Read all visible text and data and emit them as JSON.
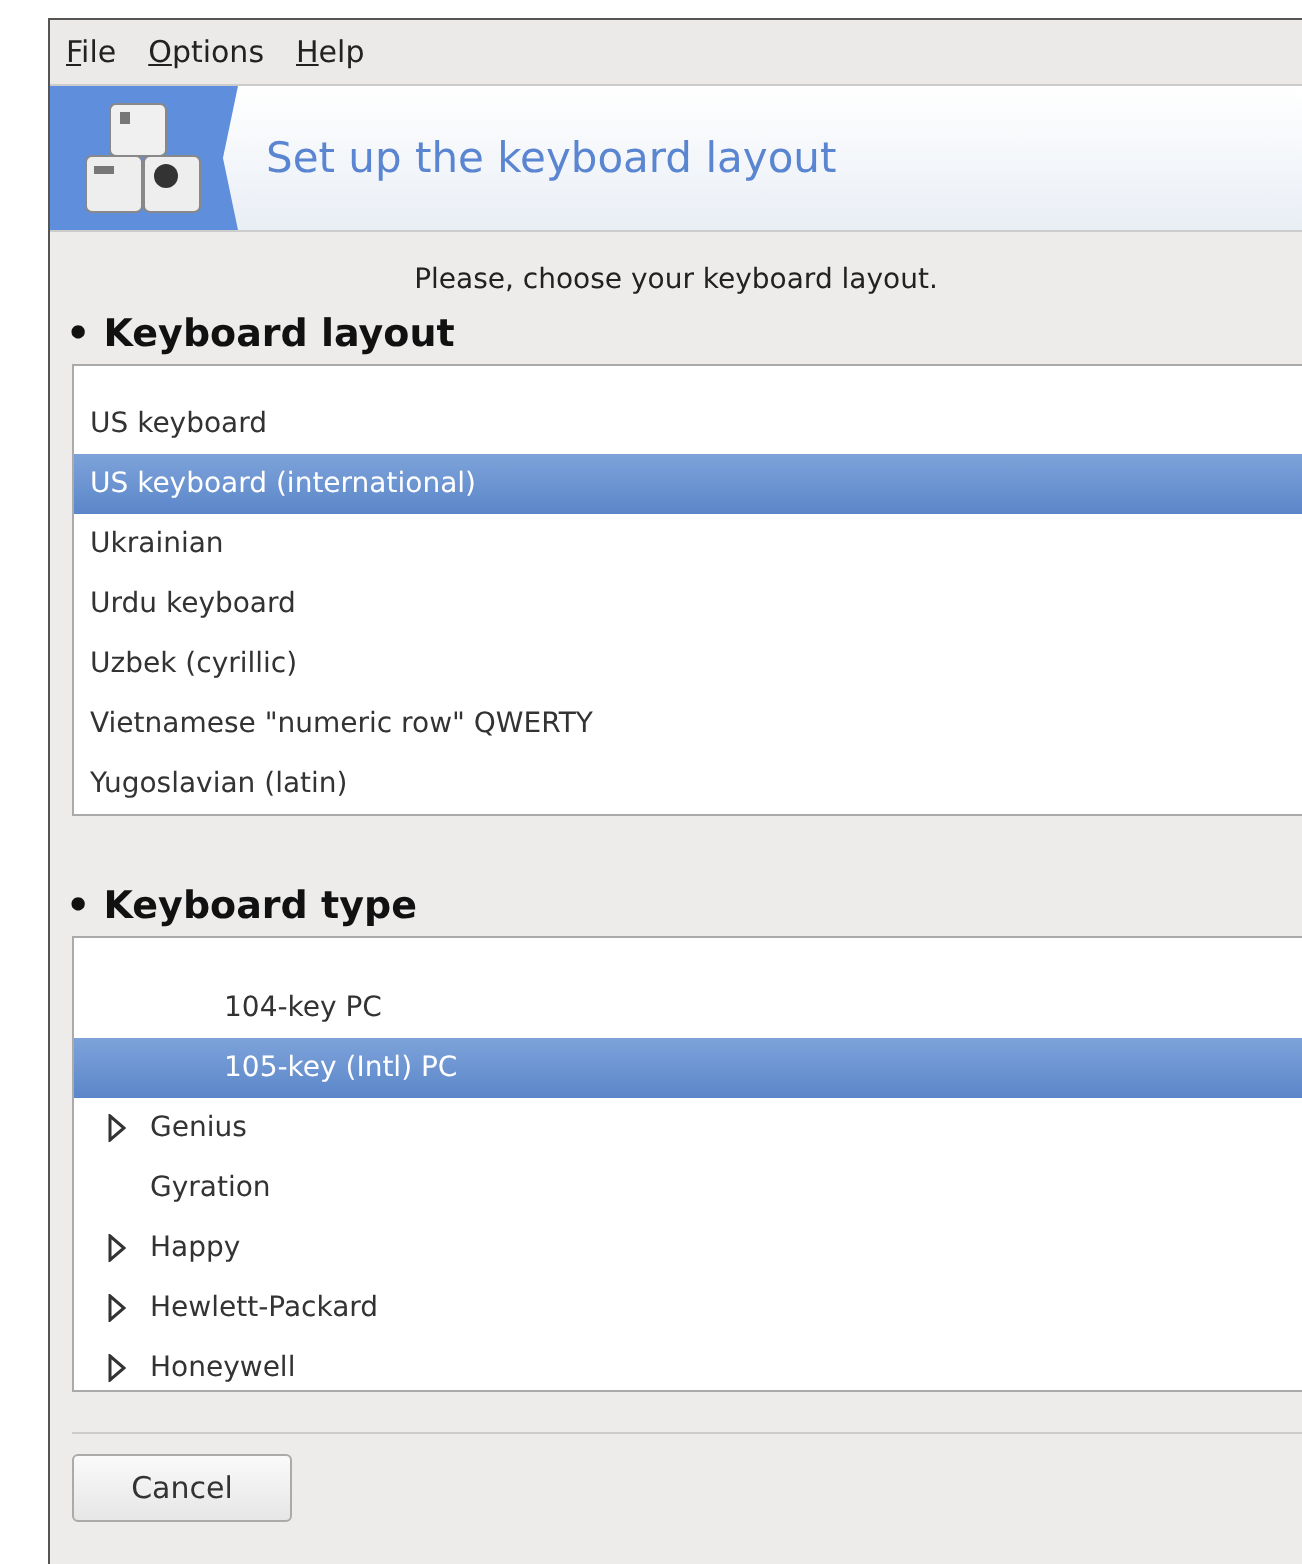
{
  "menu": [
    "File",
    "Options",
    "Help"
  ],
  "banner": {
    "title": "Set up the keyboard layout"
  },
  "prompt": "Please, choose your keyboard layout.",
  "layout_section": {
    "bullet": "•",
    "heading": "Keyboard layout",
    "items": [
      {
        "label": "US keyboard",
        "selected": false
      },
      {
        "label": "US keyboard (international)",
        "selected": true
      },
      {
        "label": "Ukrainian",
        "selected": false
      },
      {
        "label": "Urdu keyboard",
        "selected": false
      },
      {
        "label": "Uzbek (cyrillic)",
        "selected": false
      },
      {
        "label": "Vietnamese \"numeric row\" QWERTY",
        "selected": false
      },
      {
        "label": "Yugoslavian (latin)",
        "selected": false
      }
    ]
  },
  "type_section": {
    "bullet": "•",
    "heading": "Keyboard type",
    "items": [
      {
        "children": [
          {
            "label": "104-key PC",
            "selected": false
          },
          {
            "label": "105-key (Intl) PC",
            "selected": true
          }
        ]
      },
      {
        "label": "Genius",
        "has_children": true,
        "selected": false
      },
      {
        "label": "Gyration",
        "has_children": false,
        "selected": false
      },
      {
        "label": "Happy",
        "has_children": true,
        "selected": false
      },
      {
        "label": "Hewlett-Packard",
        "has_children": true,
        "selected": false
      },
      {
        "label": "Honeywell",
        "has_children": true,
        "selected": false
      }
    ]
  },
  "buttons": [
    "Cancel"
  ]
}
